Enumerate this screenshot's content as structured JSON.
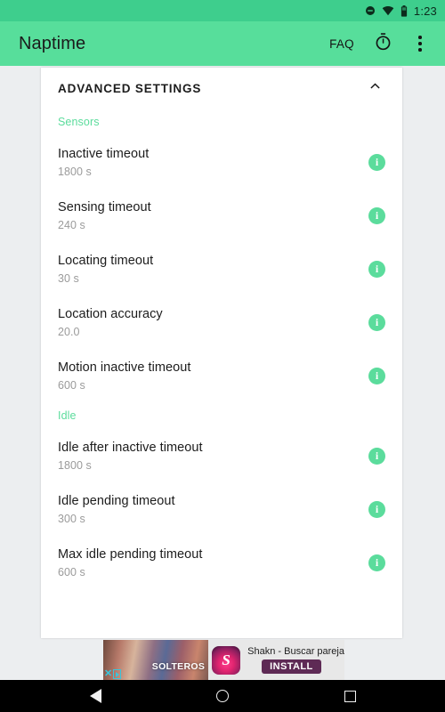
{
  "status_bar": {
    "time": "1:23",
    "icons": [
      "do-not-disturb-icon",
      "wifi-icon",
      "battery-icon"
    ],
    "background_color": "#3ECE8D"
  },
  "toolbar": {
    "title": "Naptime",
    "faq_label": "FAQ",
    "timer_icon": "timer-icon",
    "overflow_icon": "overflow-menu-icon",
    "background_color": "#57DE9B"
  },
  "card": {
    "header_title": "ADVANCED SETTINGS",
    "collapse_icon": "chevron-up-icon"
  },
  "sections": [
    {
      "label": "Sensors",
      "items": [
        {
          "title": "Inactive timeout",
          "value": "1800 s",
          "info_icon": "info-icon"
        },
        {
          "title": "Sensing timeout",
          "value": "240 s",
          "info_icon": "info-icon"
        },
        {
          "title": "Locating timeout",
          "value": "30 s",
          "info_icon": "info-icon"
        },
        {
          "title": "Location accuracy",
          "value": "20.0",
          "info_icon": "info-icon"
        },
        {
          "title": "Motion inactive timeout",
          "value": "600 s",
          "info_icon": "info-icon"
        }
      ]
    },
    {
      "label": "Idle",
      "items": [
        {
          "title": "Idle after inactive timeout",
          "value": "1800 s",
          "info_icon": "info-icon"
        },
        {
          "title": "Idle pending timeout",
          "value": "300 s",
          "info_icon": "info-icon"
        },
        {
          "title": "Max idle pending timeout",
          "value": "600 s",
          "info_icon": "info-icon"
        }
      ]
    }
  ],
  "ad": {
    "creative_text": "SOLTEROS",
    "app_icon_glyph": "S",
    "headline": "Shakn - Buscar pareja",
    "install_label": "INSTALL",
    "close_label": "✕"
  },
  "nav_bar": {
    "back": "back-icon",
    "home": "home-icon",
    "recents": "recents-icon"
  },
  "colors": {
    "accent_green": "#5BDC9C",
    "status_green": "#3ECE8D",
    "toolbar_green": "#57DE9B",
    "page_background": "#ECEEF0",
    "card_background": "#FFFFFF"
  }
}
